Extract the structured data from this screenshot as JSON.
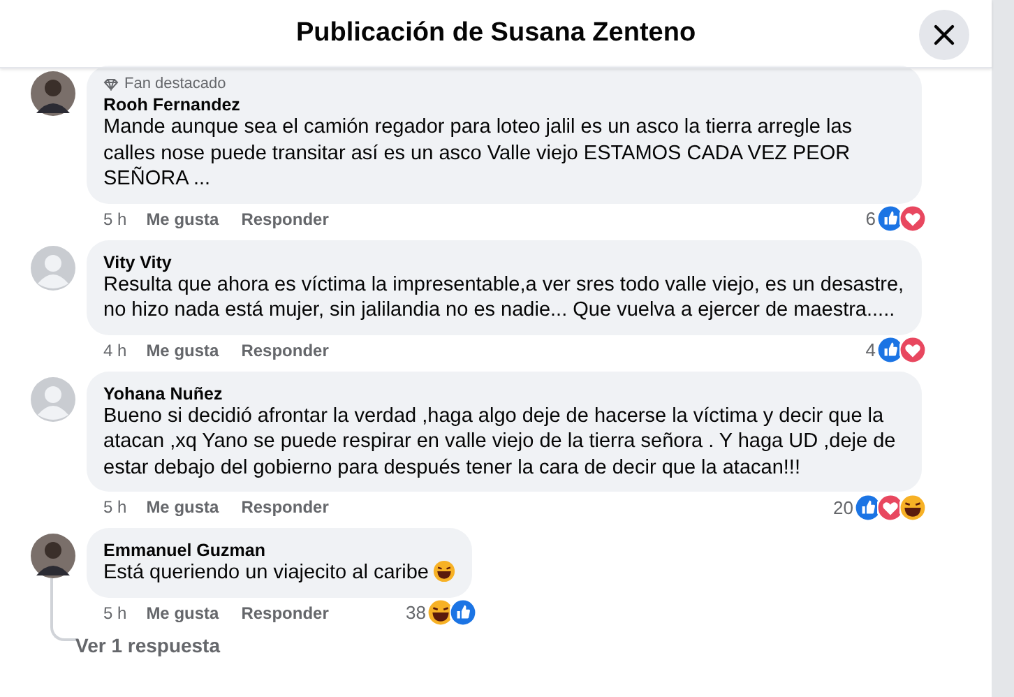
{
  "dialog": {
    "title": "Publicación de Susana Zenteno"
  },
  "comments": [
    {
      "avatar": {
        "kind": "photo"
      },
      "badge": "Fan destacado",
      "author": "Rooh Fernandez",
      "text": "Mande aunque sea el camión regador para loteo jalil es un asco la tierra arregle las calles nose puede transitar así es un asco Valle viejo ESTAMOS CADA VEZ PEOR SEÑORA ...",
      "time": "5 h",
      "like": "Me gusta",
      "reply": "Responder",
      "count": "6",
      "reactions": [
        {
          "kind": "like"
        },
        {
          "kind": "love"
        }
      ]
    },
    {
      "avatar": {
        "kind": "default"
      },
      "author": "Vity Vity",
      "text": "Resulta que ahora es víctima la impresentable,a ver sres todo valle viejo, es un desastre, no hizo nada está mujer, sin jalilandia no es nadie... Que vuelva a ejercer de maestra.....",
      "time": "4 h",
      "like": "Me gusta",
      "reply": "Responder",
      "count": "4",
      "reactions": [
        {
          "kind": "like"
        },
        {
          "kind": "love"
        }
      ]
    },
    {
      "avatar": {
        "kind": "default"
      },
      "author": "Yohana Nuñez",
      "text": "Bueno si decidió afrontar la verdad ,haga algo deje de hacerse la víctima y decir que la atacan ,xq Yano se puede respirar en valle viejo de la tierra señora . Y haga UD ,deje de estar debajo del gobierno para después tener la cara de decir que la atacan!!!",
      "time": "5 h",
      "like": "Me gusta",
      "reply": "Responder",
      "count": "20",
      "reactions": [
        {
          "kind": "like"
        },
        {
          "kind": "love"
        },
        {
          "kind": "haha"
        }
      ]
    },
    {
      "avatar": {
        "kind": "photo"
      },
      "author": "Emmanuel Guzman",
      "text": "Está queriendo un viajecito al caribe",
      "emoji": {
        "kind": "haha"
      },
      "time": "5 h",
      "like": "Me gusta",
      "reply": "Responder",
      "count": "38",
      "reactions": [
        {
          "kind": "haha"
        },
        {
          "kind": "like"
        }
      ],
      "replies_link": "Ver 1 respuesta"
    }
  ]
}
